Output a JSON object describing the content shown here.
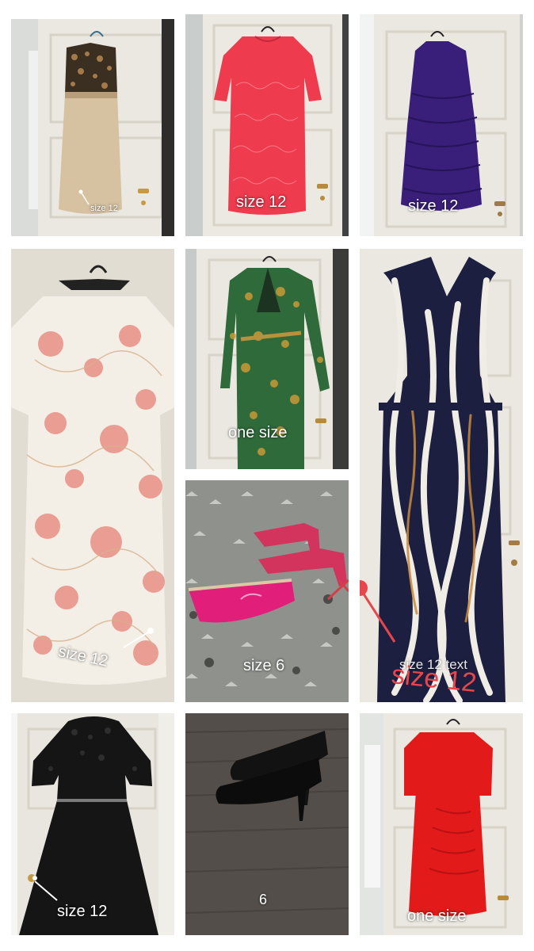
{
  "collage": {
    "tiles": [
      {
        "item": "leopard-top-satin-dress",
        "caption": "size 12"
      },
      {
        "item": "coral-lace-dress",
        "caption": "size 12"
      },
      {
        "item": "purple-tiered-dress",
        "caption": "size 12"
      },
      {
        "item": "floral-shift-dress",
        "caption": "size 12"
      },
      {
        "item": "green-print-wrap-dress",
        "caption": "one size"
      },
      {
        "item": "pink-sandals-and-clutch",
        "caption": "size 6"
      },
      {
        "item": "striped-halter-jumpsuit",
        "caption": "size 12",
        "caption_underlay": "size 12 text"
      },
      {
        "item": "black-lace-dress",
        "caption": "size 12"
      },
      {
        "item": "black-court-shoes",
        "caption": "6"
      },
      {
        "item": "red-ruched-dress",
        "caption": "one size"
      }
    ]
  },
  "colors": {
    "door": "#e9e6df",
    "caption": "#ffffff",
    "annotation_red": "#e8464d"
  }
}
